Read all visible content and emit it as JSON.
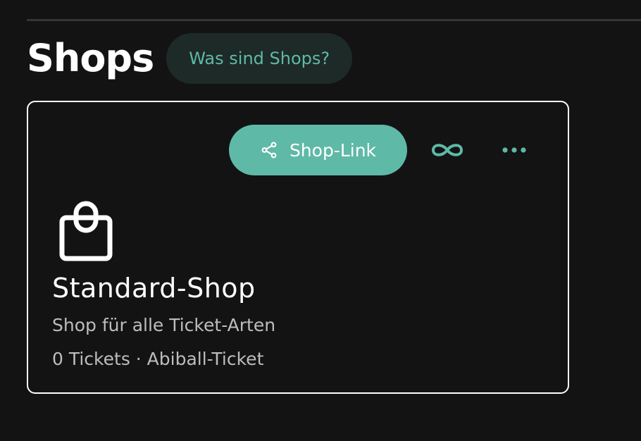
{
  "header": {
    "title": "Shops",
    "help_label": "Was sind Shops?"
  },
  "shop_card": {
    "share_label": "Shop-Link",
    "share_icon": "share-icon",
    "limit_icon": "infinity-icon",
    "menu_icon": "more-horizontal-icon",
    "shop_icon": "shopping-bag-icon",
    "name": "Standard-Shop",
    "description": "Shop für alle Ticket-Arten",
    "meta": "0 Tickets · Abiball-Ticket"
  },
  "colors": {
    "background": "#131313",
    "accent": "#5fb9a7",
    "pill_background": "#1e2a27",
    "text_primary": "#ffffff",
    "text_secondary": "#bdbdbd"
  }
}
